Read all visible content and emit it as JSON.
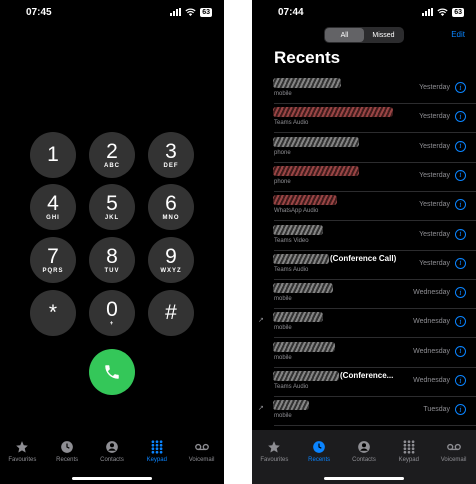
{
  "left": {
    "status": {
      "time": "07:45",
      "battery": "63"
    },
    "keys": [
      {
        "digit": "1",
        "letters": ""
      },
      {
        "digit": "2",
        "letters": "ABC"
      },
      {
        "digit": "3",
        "letters": "DEF"
      },
      {
        "digit": "4",
        "letters": "GHI"
      },
      {
        "digit": "5",
        "letters": "JKL"
      },
      {
        "digit": "6",
        "letters": "MNO"
      },
      {
        "digit": "7",
        "letters": "PQRS"
      },
      {
        "digit": "8",
        "letters": "TUV"
      },
      {
        "digit": "9",
        "letters": "WXYZ"
      },
      {
        "digit": "*",
        "letters": ""
      },
      {
        "digit": "0",
        "letters": "+"
      },
      {
        "digit": "#",
        "letters": ""
      }
    ],
    "tabs": [
      {
        "label": "Favourites",
        "icon": "star-icon"
      },
      {
        "label": "Recents",
        "icon": "clock-icon"
      },
      {
        "label": "Contacts",
        "icon": "person-icon"
      },
      {
        "label": "Keypad",
        "icon": "keypad-icon",
        "active": true
      },
      {
        "label": "Voicemail",
        "icon": "voicemail-icon"
      }
    ]
  },
  "right": {
    "status": {
      "time": "07:44",
      "battery": "63"
    },
    "segments": [
      "All",
      "Missed"
    ],
    "selected_segment": "All",
    "edit_label": "Edit",
    "title": "Recents",
    "calls": [
      {
        "name": "",
        "type": "mobile",
        "date": "Yesterday",
        "missed": false
      },
      {
        "name": "",
        "type": "Teams Audio",
        "date": "Yesterday",
        "missed": true
      },
      {
        "name": "",
        "type": "phone",
        "date": "Yesterday",
        "missed": false
      },
      {
        "name": "",
        "type": "phone",
        "date": "Yesterday",
        "missed": true
      },
      {
        "name": "",
        "type": "WhatsApp Audio",
        "date": "Yesterday",
        "missed": true
      },
      {
        "name": "",
        "type": "Teams Video",
        "date": "Yesterday",
        "missed": false
      },
      {
        "name": "(Conference Call)",
        "type": "Teams Audio",
        "date": "Yesterday",
        "missed": false
      },
      {
        "name": "",
        "type": "mobile",
        "date": "Wednesday",
        "missed": false
      },
      {
        "name": "",
        "type": "mobile",
        "date": "Wednesday",
        "missed": false,
        "outgoing": true
      },
      {
        "name": "",
        "type": "mobile",
        "date": "Wednesday",
        "missed": false
      },
      {
        "name": "(Conference...",
        "type": "Teams Audio",
        "date": "Wednesday",
        "missed": false
      },
      {
        "name": "",
        "type": "mobile",
        "date": "Tuesday",
        "missed": false,
        "outgoing": true
      },
      {
        "name": "",
        "type": "",
        "date": "Tuesday",
        "missed": false,
        "outgoing": true
      }
    ],
    "tabs": [
      {
        "label": "Favourites",
        "icon": "star-icon"
      },
      {
        "label": "Recents",
        "icon": "clock-icon",
        "active": true
      },
      {
        "label": "Contacts",
        "icon": "person-icon"
      },
      {
        "label": "Keypad",
        "icon": "keypad-icon"
      },
      {
        "label": "Voicemail",
        "icon": "voicemail-icon"
      }
    ]
  },
  "colors": {
    "accent": "#0a84ff",
    "call_green": "#34c759",
    "key_gray": "#333333",
    "missed_red": "#ff453a"
  }
}
